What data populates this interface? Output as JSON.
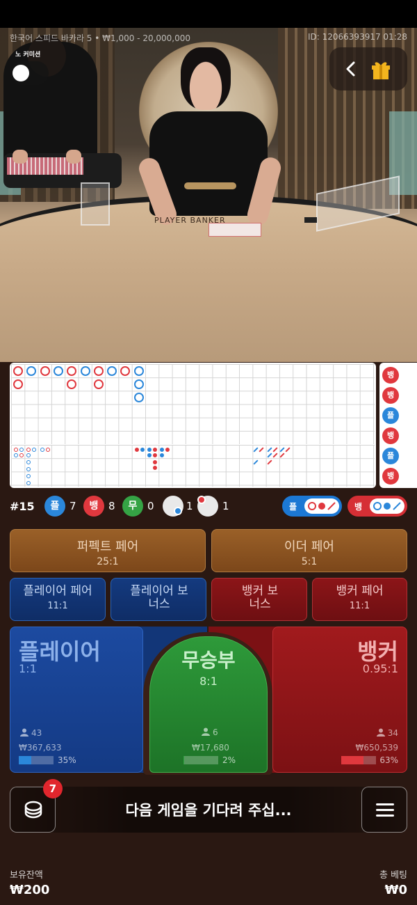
{
  "header": {
    "table_info": "한국어 스피드 바카라 5 • ₩1,000 - 20,000,000",
    "game_id": "ID: 12066393917 01:28",
    "no_commission_label": "노 커미션",
    "no_commission_on": false,
    "back_icon": "chevron-left-icon",
    "gift_icon": "gift-icon"
  },
  "video": {
    "table_text": "PLAYER BANKER"
  },
  "roadmap": {
    "big_road_columns": [
      [
        "B",
        "B"
      ],
      [
        "P"
      ],
      [
        "B"
      ],
      [
        "P"
      ],
      [
        "B",
        "B"
      ],
      [
        "P"
      ],
      [
        "B",
        "B"
      ],
      [
        "P"
      ],
      [
        "B"
      ],
      [
        "P",
        "P",
        "P"
      ]
    ],
    "bead_plate": [
      "뱅",
      "뱅",
      "플",
      "뱅",
      "플",
      "뱅"
    ],
    "bead_plate_side": [
      "B",
      "B",
      "P",
      "B",
      "P",
      "B"
    ]
  },
  "stats": {
    "round": "#15",
    "player_label": "플",
    "player_count": "7",
    "banker_label": "뱅",
    "banker_count": "8",
    "tie_label": "무",
    "tie_count": "0",
    "player_pair_count": "1",
    "banker_pair_count": "1",
    "player_ask_label": "플",
    "banker_ask_label": "뱅"
  },
  "bets": {
    "perfect_pair": {
      "name": "퍼펙트 페어",
      "odds": "25:1"
    },
    "either_pair": {
      "name": "이더 페어",
      "odds": "5:1"
    },
    "player_pair": {
      "name": "플레이어 페어",
      "odds": "11:1"
    },
    "player_bonus": {
      "name": "플레이어 보너스"
    },
    "banker_bonus": {
      "name": "뱅커 보너스"
    },
    "banker_pair": {
      "name": "뱅커 페어",
      "odds": "11:1"
    },
    "player": {
      "name": "플레이어",
      "odds": "1:1",
      "bettors": "43",
      "pool": "₩367,633",
      "percent": "35%",
      "share": 0.35
    },
    "tie": {
      "name": "무승부",
      "odds": "8:1",
      "bettors": "6",
      "pool": "₩17,680",
      "percent": "2%",
      "share": 0.02
    },
    "banker": {
      "name": "뱅커",
      "odds": "0.95:1",
      "bettors": "34",
      "pool": "₩650,539",
      "percent": "63%",
      "share": 0.63
    }
  },
  "bottom": {
    "chip_count": "7",
    "message": "다음 게임을 기다려 주십...",
    "menu_icon": "hamburger-menu-icon",
    "balance_label": "보유잔액",
    "balance_value": "₩200",
    "total_bet_label": "총 베팅",
    "total_bet_value": "₩0"
  },
  "colors": {
    "player": "#2b87da",
    "banker": "#e0383e",
    "tie": "#35a345",
    "side_bet": "#8a5420"
  }
}
